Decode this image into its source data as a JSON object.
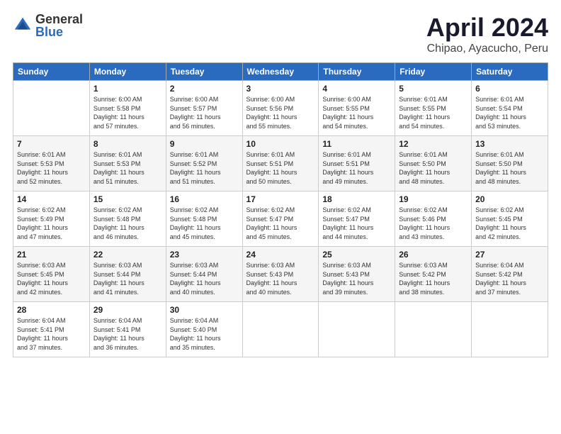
{
  "logo": {
    "general": "General",
    "blue": "Blue"
  },
  "title": {
    "month": "April 2024",
    "location": "Chipao, Ayacucho, Peru"
  },
  "headers": [
    "Sunday",
    "Monday",
    "Tuesday",
    "Wednesday",
    "Thursday",
    "Friday",
    "Saturday"
  ],
  "weeks": [
    [
      {
        "day": "",
        "info": ""
      },
      {
        "day": "1",
        "info": "Sunrise: 6:00 AM\nSunset: 5:58 PM\nDaylight: 11 hours\nand 57 minutes."
      },
      {
        "day": "2",
        "info": "Sunrise: 6:00 AM\nSunset: 5:57 PM\nDaylight: 11 hours\nand 56 minutes."
      },
      {
        "day": "3",
        "info": "Sunrise: 6:00 AM\nSunset: 5:56 PM\nDaylight: 11 hours\nand 55 minutes."
      },
      {
        "day": "4",
        "info": "Sunrise: 6:00 AM\nSunset: 5:55 PM\nDaylight: 11 hours\nand 54 minutes."
      },
      {
        "day": "5",
        "info": "Sunrise: 6:01 AM\nSunset: 5:55 PM\nDaylight: 11 hours\nand 54 minutes."
      },
      {
        "day": "6",
        "info": "Sunrise: 6:01 AM\nSunset: 5:54 PM\nDaylight: 11 hours\nand 53 minutes."
      }
    ],
    [
      {
        "day": "7",
        "info": "Sunrise: 6:01 AM\nSunset: 5:53 PM\nDaylight: 11 hours\nand 52 minutes."
      },
      {
        "day": "8",
        "info": "Sunrise: 6:01 AM\nSunset: 5:53 PM\nDaylight: 11 hours\nand 51 minutes."
      },
      {
        "day": "9",
        "info": "Sunrise: 6:01 AM\nSunset: 5:52 PM\nDaylight: 11 hours\nand 51 minutes."
      },
      {
        "day": "10",
        "info": "Sunrise: 6:01 AM\nSunset: 5:51 PM\nDaylight: 11 hours\nand 50 minutes."
      },
      {
        "day": "11",
        "info": "Sunrise: 6:01 AM\nSunset: 5:51 PM\nDaylight: 11 hours\nand 49 minutes."
      },
      {
        "day": "12",
        "info": "Sunrise: 6:01 AM\nSunset: 5:50 PM\nDaylight: 11 hours\nand 48 minutes."
      },
      {
        "day": "13",
        "info": "Sunrise: 6:01 AM\nSunset: 5:50 PM\nDaylight: 11 hours\nand 48 minutes."
      }
    ],
    [
      {
        "day": "14",
        "info": "Sunrise: 6:02 AM\nSunset: 5:49 PM\nDaylight: 11 hours\nand 47 minutes."
      },
      {
        "day": "15",
        "info": "Sunrise: 6:02 AM\nSunset: 5:48 PM\nDaylight: 11 hours\nand 46 minutes."
      },
      {
        "day": "16",
        "info": "Sunrise: 6:02 AM\nSunset: 5:48 PM\nDaylight: 11 hours\nand 45 minutes."
      },
      {
        "day": "17",
        "info": "Sunrise: 6:02 AM\nSunset: 5:47 PM\nDaylight: 11 hours\nand 45 minutes."
      },
      {
        "day": "18",
        "info": "Sunrise: 6:02 AM\nSunset: 5:47 PM\nDaylight: 11 hours\nand 44 minutes."
      },
      {
        "day": "19",
        "info": "Sunrise: 6:02 AM\nSunset: 5:46 PM\nDaylight: 11 hours\nand 43 minutes."
      },
      {
        "day": "20",
        "info": "Sunrise: 6:02 AM\nSunset: 5:45 PM\nDaylight: 11 hours\nand 42 minutes."
      }
    ],
    [
      {
        "day": "21",
        "info": "Sunrise: 6:03 AM\nSunset: 5:45 PM\nDaylight: 11 hours\nand 42 minutes."
      },
      {
        "day": "22",
        "info": "Sunrise: 6:03 AM\nSunset: 5:44 PM\nDaylight: 11 hours\nand 41 minutes."
      },
      {
        "day": "23",
        "info": "Sunrise: 6:03 AM\nSunset: 5:44 PM\nDaylight: 11 hours\nand 40 minutes."
      },
      {
        "day": "24",
        "info": "Sunrise: 6:03 AM\nSunset: 5:43 PM\nDaylight: 11 hours\nand 40 minutes."
      },
      {
        "day": "25",
        "info": "Sunrise: 6:03 AM\nSunset: 5:43 PM\nDaylight: 11 hours\nand 39 minutes."
      },
      {
        "day": "26",
        "info": "Sunrise: 6:03 AM\nSunset: 5:42 PM\nDaylight: 11 hours\nand 38 minutes."
      },
      {
        "day": "27",
        "info": "Sunrise: 6:04 AM\nSunset: 5:42 PM\nDaylight: 11 hours\nand 37 minutes."
      }
    ],
    [
      {
        "day": "28",
        "info": "Sunrise: 6:04 AM\nSunset: 5:41 PM\nDaylight: 11 hours\nand 37 minutes."
      },
      {
        "day": "29",
        "info": "Sunrise: 6:04 AM\nSunset: 5:41 PM\nDaylight: 11 hours\nand 36 minutes."
      },
      {
        "day": "30",
        "info": "Sunrise: 6:04 AM\nSunset: 5:40 PM\nDaylight: 11 hours\nand 35 minutes."
      },
      {
        "day": "",
        "info": ""
      },
      {
        "day": "",
        "info": ""
      },
      {
        "day": "",
        "info": ""
      },
      {
        "day": "",
        "info": ""
      }
    ]
  ]
}
